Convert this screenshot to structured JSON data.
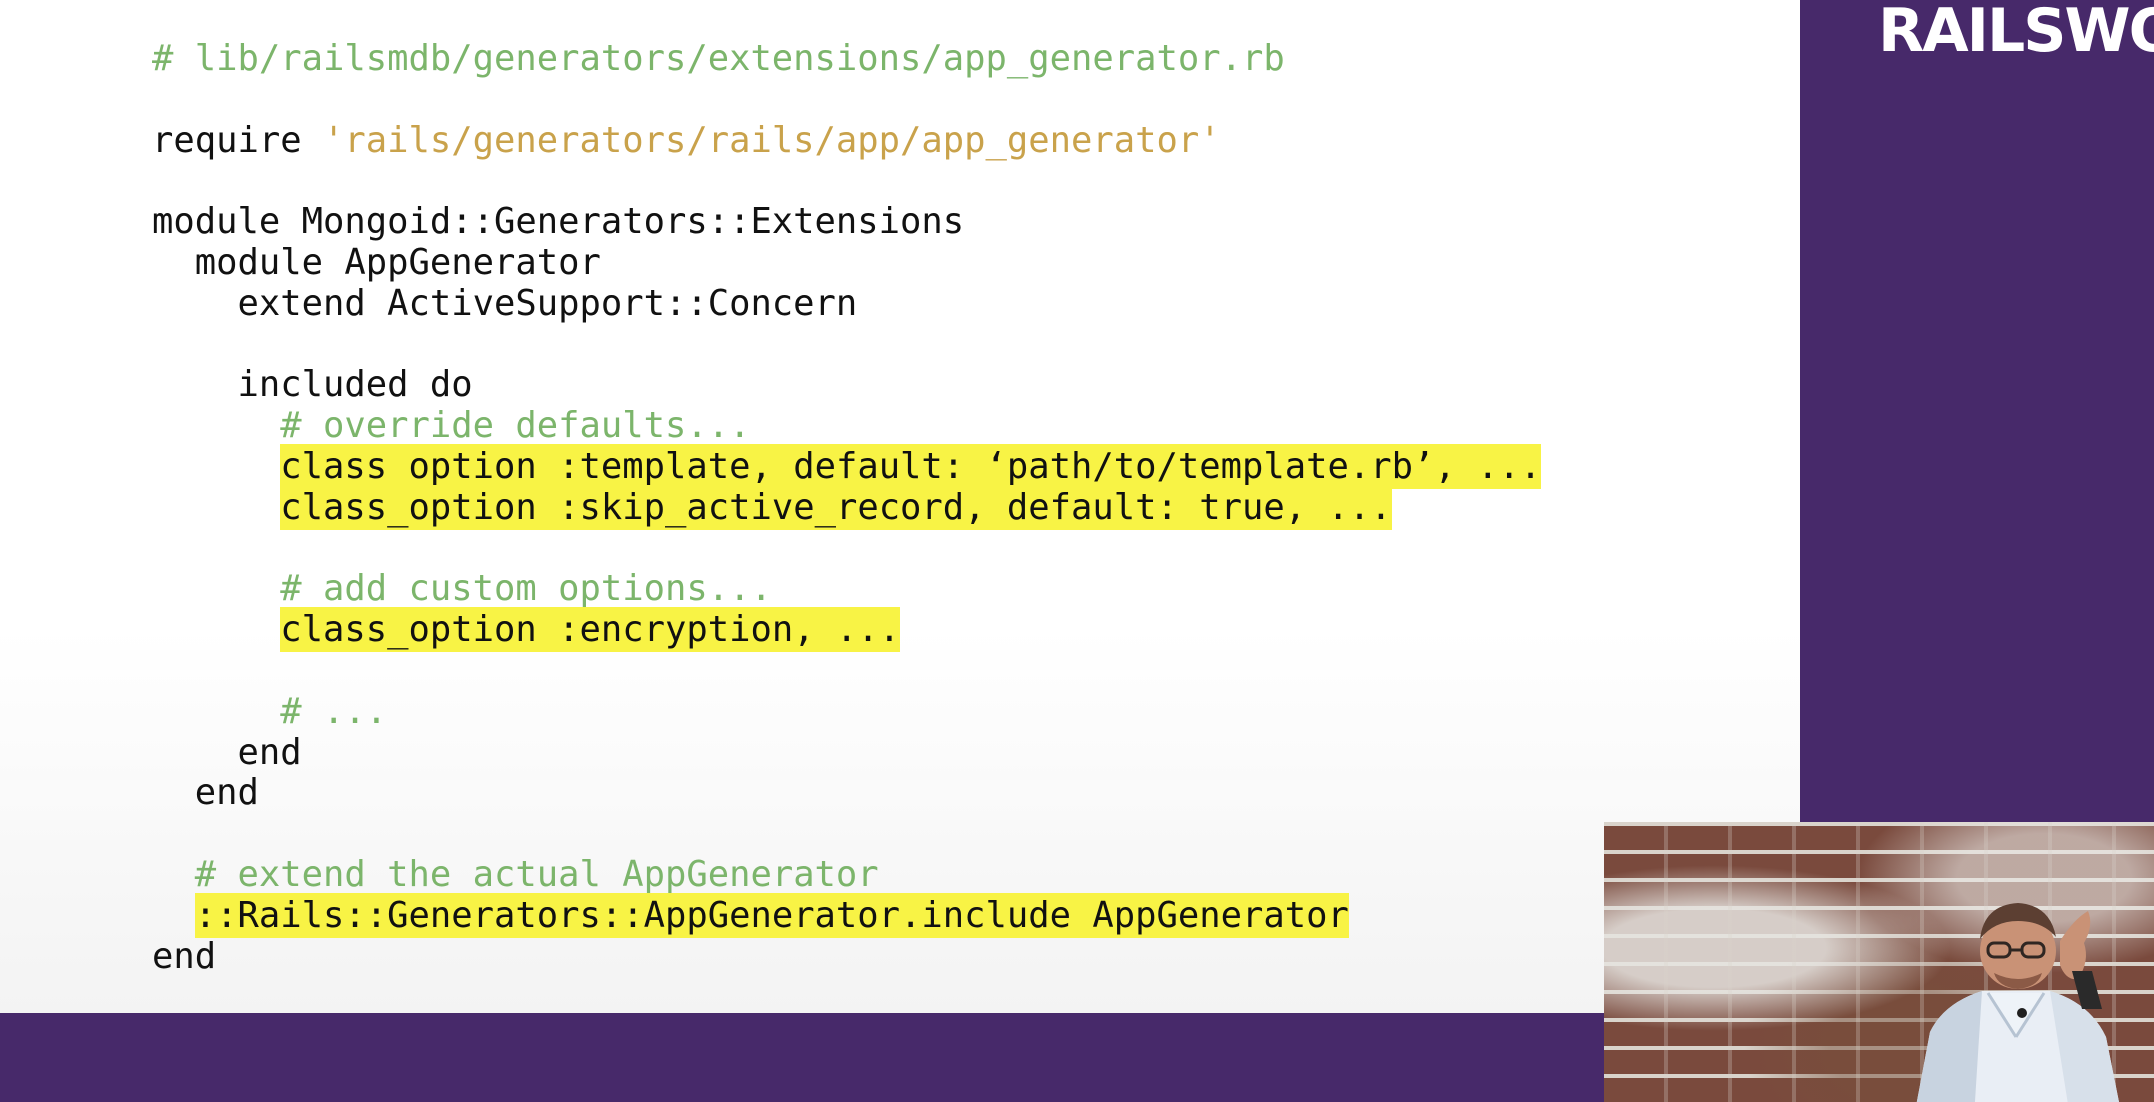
{
  "code": {
    "lines": [
      {
        "parts": [
          {
            "text": "# lib/railsmdb/generators/extensions/app_generator.rb",
            "kind": "comment"
          }
        ]
      },
      {
        "parts": [
          {
            "text": "",
            "kind": "plain"
          }
        ]
      },
      {
        "parts": [
          {
            "text": "require ",
            "kind": "plain"
          },
          {
            "text": "'rails/generators/rails/app/app_generator'",
            "kind": "string"
          }
        ]
      },
      {
        "parts": [
          {
            "text": "",
            "kind": "plain"
          }
        ]
      },
      {
        "parts": [
          {
            "text": "module Mongoid::Generators::Extensions",
            "kind": "plain"
          }
        ]
      },
      {
        "parts": [
          {
            "text": "  module AppGenerator",
            "kind": "plain"
          }
        ]
      },
      {
        "parts": [
          {
            "text": "    extend ActiveSupport::Concern",
            "kind": "plain"
          }
        ]
      },
      {
        "parts": [
          {
            "text": "",
            "kind": "plain"
          }
        ]
      },
      {
        "parts": [
          {
            "text": "    included do",
            "kind": "plain"
          }
        ]
      },
      {
        "parts": [
          {
            "text": "      ",
            "kind": "plain"
          },
          {
            "text": "# override defaults...",
            "kind": "comment"
          }
        ]
      },
      {
        "parts": [
          {
            "text": "      ",
            "kind": "plain"
          },
          {
            "text": "class_option :template, default: ‘path/to/template.rb’, ...",
            "kind": "plain",
            "highlight": true
          }
        ]
      },
      {
        "parts": [
          {
            "text": "      ",
            "kind": "plain"
          },
          {
            "text": "class_option :skip_active_record, default: true, ...",
            "kind": "plain",
            "highlight": true
          }
        ]
      },
      {
        "parts": [
          {
            "text": "",
            "kind": "plain"
          }
        ]
      },
      {
        "parts": [
          {
            "text": "      ",
            "kind": "plain"
          },
          {
            "text": "# add custom options...",
            "kind": "comment"
          }
        ]
      },
      {
        "parts": [
          {
            "text": "      ",
            "kind": "plain"
          },
          {
            "text": "class_option :encryption, ...",
            "kind": "plain",
            "highlight": true
          }
        ]
      },
      {
        "parts": [
          {
            "text": "",
            "kind": "plain"
          }
        ]
      },
      {
        "parts": [
          {
            "text": "      ",
            "kind": "plain"
          },
          {
            "text": "# ...",
            "kind": "comment"
          }
        ]
      },
      {
        "parts": [
          {
            "text": "    end",
            "kind": "plain"
          }
        ]
      },
      {
        "parts": [
          {
            "text": "  end",
            "kind": "plain"
          }
        ]
      },
      {
        "parts": [
          {
            "text": "",
            "kind": "plain"
          }
        ]
      },
      {
        "parts": [
          {
            "text": "  ",
            "kind": "plain"
          },
          {
            "text": "# extend the actual AppGenerator",
            "kind": "comment"
          }
        ]
      },
      {
        "parts": [
          {
            "text": "  ",
            "kind": "plain"
          },
          {
            "text": "::Rails::Generators::AppGenerator.include AppGenerator",
            "kind": "plain",
            "highlight": true
          }
        ]
      },
      {
        "parts": [
          {
            "text": "end",
            "kind": "plain"
          }
        ]
      }
    ]
  },
  "sidebar": {
    "logo_text": "RAILSWO"
  },
  "colors": {
    "brand_purple": "#47296a",
    "highlight": "#f8f345",
    "comment": "#7cb56b",
    "string": "#c9a24b"
  },
  "icons": {
    "speaker": "person-icon"
  }
}
